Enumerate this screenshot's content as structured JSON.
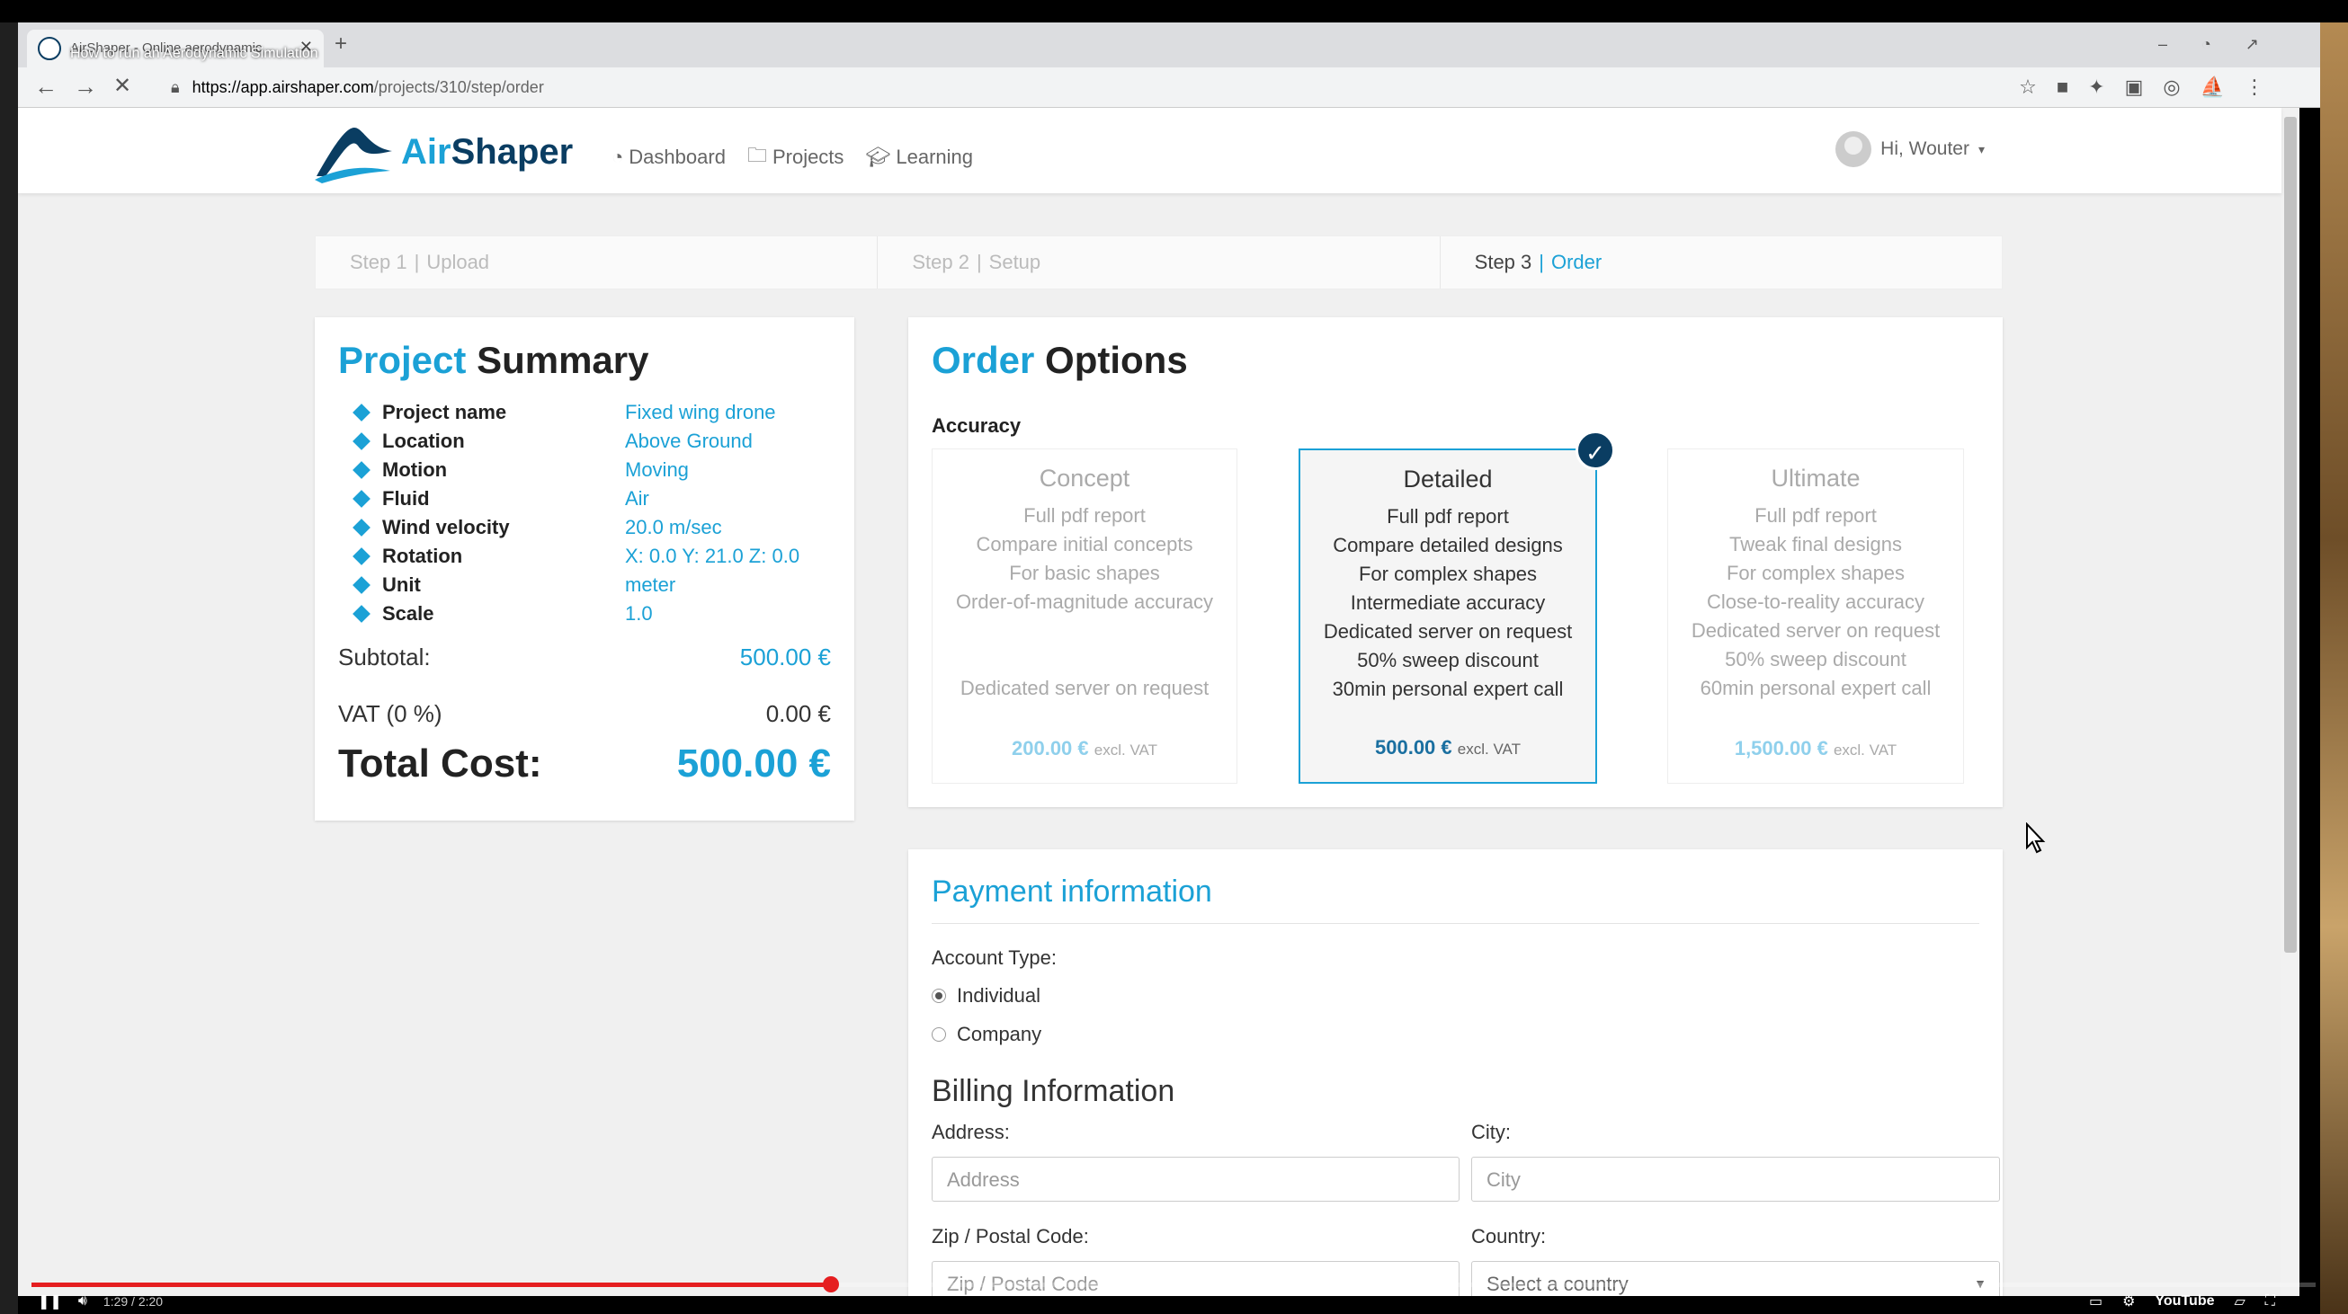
{
  "browser": {
    "tab_title": "AirShaper - Online aerodynamic",
    "video_title": "How to run an Aerodynamic Simulation",
    "url_domain": "https://app.airshaper.com",
    "url_path": "/projects/310/step/order"
  },
  "nav": {
    "brand_air": "Air",
    "brand_shaper": "Shaper",
    "dashboard": "Dashboard",
    "projects": "Projects",
    "learning": "Learning",
    "greeting": "Hi, Wouter"
  },
  "steps": [
    {
      "num": "Step 1",
      "label": "Upload"
    },
    {
      "num": "Step 2",
      "label": "Setup"
    },
    {
      "num": "Step 3",
      "label": "Order"
    }
  ],
  "summary": {
    "title_blue": "Project",
    "title_dark": "Summary",
    "props": [
      {
        "k": "Project name",
        "v": "Fixed wing drone"
      },
      {
        "k": "Location",
        "v": "Above Ground"
      },
      {
        "k": "Motion",
        "v": "Moving"
      },
      {
        "k": "Fluid",
        "v": "Air"
      },
      {
        "k": "Wind velocity",
        "v": "20.0 m/sec"
      },
      {
        "k": "Rotation",
        "v": "X: 0.0 Y: 21.0 Z: 0.0"
      },
      {
        "k": "Unit",
        "v": "meter"
      },
      {
        "k": "Scale",
        "v": "1.0"
      }
    ],
    "subtotal_label": "Subtotal:",
    "subtotal_value": "500.00 €",
    "vat_label": "VAT (0 %)",
    "vat_value": "0.00 €",
    "total_label": "Total Cost:",
    "total_value": "500.00 €"
  },
  "order": {
    "title_blue": "Order",
    "title_dark": "Options",
    "accuracy_label": "Accuracy",
    "options": [
      {
        "title": "Concept",
        "lines": [
          "Full pdf report",
          "Compare initial concepts",
          "For basic shapes",
          "Order-of-magnitude accuracy",
          "",
          "",
          "Dedicated server on request"
        ],
        "price": "200.00 €",
        "excl": "excl. VAT"
      },
      {
        "title": "Detailed",
        "lines": [
          "Full pdf report",
          "Compare detailed designs",
          "For complex shapes",
          "Intermediate accuracy",
          "Dedicated server on request",
          "50% sweep discount",
          "30min personal expert call"
        ],
        "price": "500.00 €",
        "excl": "excl. VAT"
      },
      {
        "title": "Ultimate",
        "lines": [
          "Full pdf report",
          "Tweak final designs",
          "For complex shapes",
          "Close-to-reality accuracy",
          "Dedicated server on request",
          "50% sweep discount",
          "60min personal expert call"
        ],
        "price": "1,500.00 €",
        "excl": "excl. VAT"
      }
    ]
  },
  "payment": {
    "title": "Payment information",
    "account_type_label": "Account Type:",
    "individual": "Individual",
    "company": "Company",
    "billing_title": "Billing Information",
    "address_label": "Address:",
    "address_placeholder": "Address",
    "city_label": "City:",
    "city_placeholder": "City",
    "zip_label": "Zip / Postal Code:",
    "zip_placeholder": "Zip / Postal Code",
    "country_label": "Country:",
    "country_placeholder": "Select a country"
  },
  "player": {
    "progress": 0.35,
    "time": "1:29 / 2:20",
    "youtube_label": "YouTube"
  }
}
